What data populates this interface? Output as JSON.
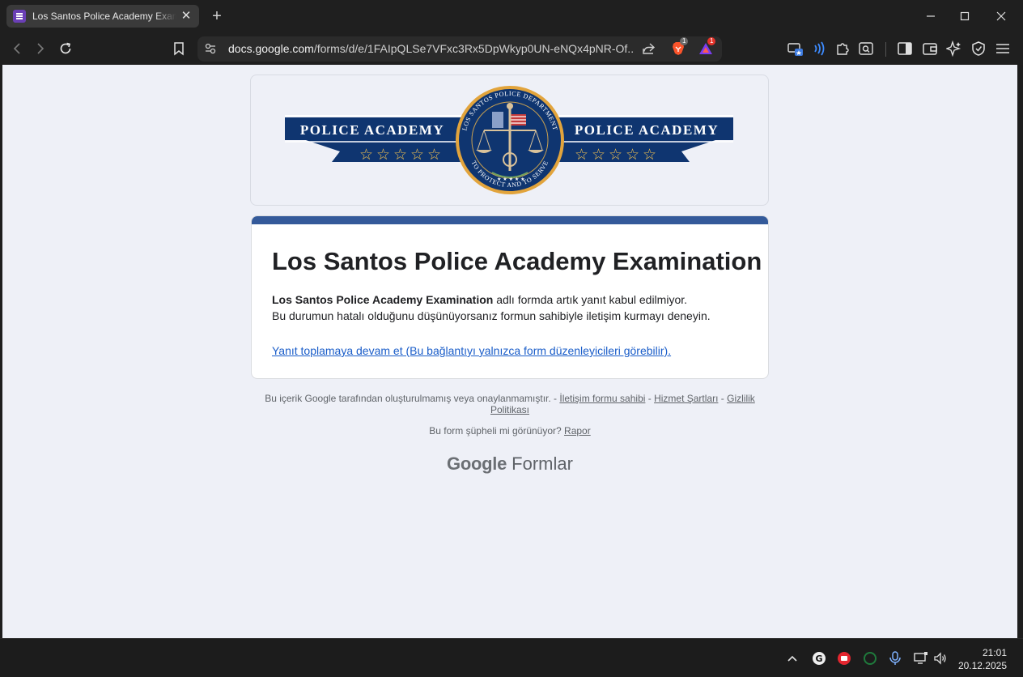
{
  "browser": {
    "tab_title": "Los Santos Police Academy Examination",
    "url_host": "docs.google.com",
    "url_path": "/forms/d/e/1FAIpQLSe7VFxc3Rx5DpWkyp0UN-eNQx4pNR-Of...",
    "brave_shield_badge": "1",
    "rewards_badge": "1"
  },
  "banner": {
    "left_text": "POLICE ACADEMY",
    "right_text": "POLICE ACADEMY",
    "seal_top_text": "LOS SANTOS POLICE DEPARTMENT",
    "seal_bottom_text": "TO PROTECT AND TO SERVE"
  },
  "form": {
    "title": "Los Santos Police Academy Examination",
    "message_bold": "Los Santos Police Academy Examination",
    "message_rest": " adlı formda artık yanıt kabul edilmiyor.",
    "message_line2": "Bu durumun hatalı olduğunu düşünüyorsanız formun sahibiyle iletişim kurmayı deneyin.",
    "continue_link": "Yanıt toplamaya devam et (Bu bağlantıyı yalnızca form düzenleyicileri görebilir)."
  },
  "footer": {
    "disclaimer": "Bu içerik Google tarafından oluşturulmamış veya onaylanmamıştır. - ",
    "contact_link": "İletişim formu sahibi",
    "sep": " - ",
    "terms_link": "Hizmet Şartları",
    "privacy_link": "Gizlilik Politikası",
    "suspicious_text": "Bu form şüpheli mi görünüyor? ",
    "report_link": "Rapor",
    "brand_google": "Google",
    "brand_product": "Formlar"
  },
  "taskbar": {
    "time": "21:01",
    "date": "20.12.2025"
  },
  "colors": {
    "form_accent": "#345a9a",
    "banner_navy": "#0f3570",
    "seal_gold": "#e2a43c",
    "link_blue": "#1a5dc9"
  }
}
